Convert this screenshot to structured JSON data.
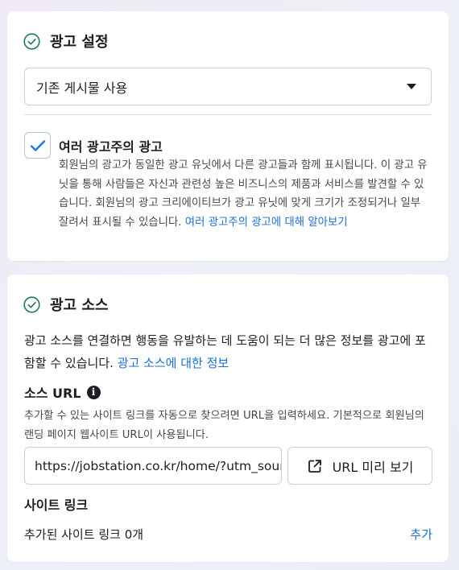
{
  "ad_settings": {
    "title": "광고 설정",
    "dropdown_value": "기존 게시물 사용",
    "multi_advertiser": {
      "checked": true,
      "title": "여러 광고주의 광고",
      "description": "회원님의 광고가 동일한 광고 유닛에서 다른 광고들과 함께 표시됩니다. 이 광고 유닛을 통해 사람들은 자신과 관련성 높은 비즈니스의 제품과 서비스를 발견할 수 있습니다. 회원님의 광고 크리에이티브가 광고 유닛에 맞게 크기가 조정되거나 일부 잘려서 표시될 수 있습니다. ",
      "learn_more": "여러 광고주의 광고에 대해 알아보기"
    }
  },
  "ad_source": {
    "title": "광고 소스",
    "description": "광고 소스를 연결하면 행동을 유발하는 데 도움이 되는 더 많은 정보를 광고에 포함할 수 있습니다. ",
    "info_link": "광고 소스에 대한 정보",
    "source_url": {
      "label": "소스 URL",
      "help": "추가할 수 있는 사이트 링크를 자동으로 찾으려면 URL을 입력하세요. 기본적으로 회원님의 랜딩 페이지 웹사이트 URL이 사용됩니다.",
      "value": "https://jobstation.co.kr/home/?utm_source=facebook",
      "preview_button": "URL 미리 보기"
    },
    "site_links": {
      "label": "사이트 링크",
      "count_text": "추가된 사이트 링크 0개",
      "add_label": "추가"
    }
  },
  "colors": {
    "accent_link": "#1a6ed8",
    "check_green": "#1f7a4d",
    "checkbox_blue": "#1877f2"
  },
  "icons": [
    "check-circle-icon",
    "chevron-down-icon",
    "checkmark-icon",
    "info-icon",
    "external-link-icon"
  ]
}
